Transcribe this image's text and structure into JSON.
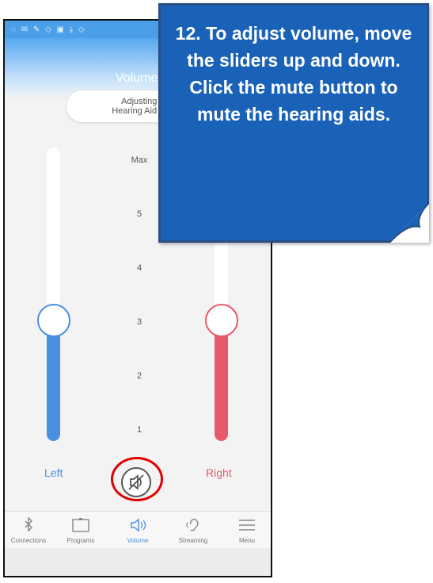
{
  "status_bar": {
    "icons": "◌ ✉ ✎ ◇ ▣ ⤓ ◇"
  },
  "app_bar": {
    "title": "Volume"
  },
  "mode_pill": {
    "line1": "Adjusting Ea",
    "line2": "Hearing Aid Sepa"
  },
  "scale": {
    "labels": [
      "Max",
      "5",
      "4",
      "3",
      "2",
      "1"
    ]
  },
  "sliders": {
    "left": {
      "label": "Left",
      "level": 0.5,
      "color": "#4a90e2"
    },
    "right": {
      "label": "Right",
      "level": 0.5,
      "color": "#e85a6a"
    }
  },
  "mute_button": {
    "icon": "speaker-muted-icon"
  },
  "nav": {
    "items": [
      {
        "label": "Connections",
        "icon": "bluetooth-icon"
      },
      {
        "label": "Programs",
        "icon": "programs-icon"
      },
      {
        "label": "Volume",
        "icon": "speaker-icon"
      },
      {
        "label": "Streaming",
        "icon": "ear-icon"
      },
      {
        "label": "Menu",
        "icon": "hamburger-menu-icon"
      }
    ],
    "active_color": "#4a90e2"
  },
  "callout": {
    "text": "12. To adjust volume, move the sliders up and down. Click the mute button to mute the hearing aids."
  }
}
